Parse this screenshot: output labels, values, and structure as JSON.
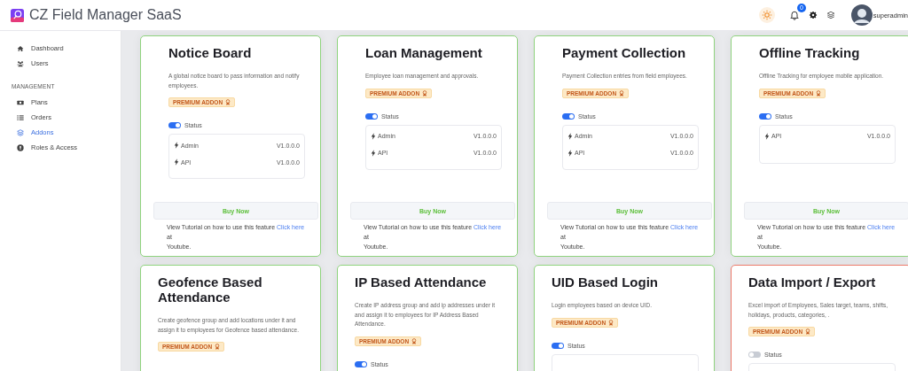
{
  "header": {
    "app_name": "CZ Field Manager SaaS",
    "notification_count": "0",
    "user_name": "superadmin"
  },
  "sidebar": {
    "groups": [
      {
        "items": [
          {
            "label": "Dashboard",
            "selected": false
          },
          {
            "label": "Users",
            "selected": false
          }
        ]
      },
      {
        "heading": "MANAGEMENT",
        "items": [
          {
            "label": "Plans",
            "selected": false
          },
          {
            "label": "Orders",
            "selected": false
          },
          {
            "label": "Addons",
            "selected": true
          },
          {
            "label": "Roles & Access",
            "selected": false
          }
        ]
      }
    ]
  },
  "cards": [
    {
      "title": "Notice Board",
      "description": "A global notice board to pass information and notify employees.",
      "badge": "PREMIUM ADDON",
      "status_label": "Status",
      "status_on": true,
      "modules": [
        {
          "name": "Admin",
          "version": "V1.0.0.0"
        },
        {
          "name": "API",
          "version": "V1.0.0.0"
        }
      ],
      "action": "Buy Now",
      "tutorial": {
        "text": "View Tutorial on how to use this feature",
        "link": "Click here",
        "line_2": "at",
        "line_3": "Youtube."
      }
    },
    {
      "title": "Loan Management",
      "description": "Employee loan management and approvals.",
      "badge": "PREMIUM ADDON",
      "status_label": "Status",
      "status_on": true,
      "modules": [
        {
          "name": "Admin",
          "version": "V1.0.0.0"
        },
        {
          "name": "API",
          "version": "V1.0.0.0"
        }
      ],
      "action": "Buy Now",
      "tutorial": {
        "text": "View Tutorial on how to use this feature",
        "link": "Click here",
        "line_2": "at",
        "line_3": "Youtube."
      }
    },
    {
      "title": "Payment Collection",
      "description": "Payment Collection entries from field employees.",
      "badge": "PREMIUM ADDON",
      "status_label": "Status",
      "status_on": true,
      "modules": [
        {
          "name": "Admin",
          "version": "V1.0.0.0"
        },
        {
          "name": "API",
          "version": "V1.0.0.0"
        }
      ],
      "action": "Buy Now",
      "tutorial": {
        "text": "View Tutorial on how to use this feature",
        "link": "Click here",
        "line_2": "at",
        "line_3": "Youtube."
      }
    },
    {
      "title": "Offline Tracking",
      "description": "Offline Tracking for employee mobile application.",
      "badge": "PREMIUM ADDON",
      "status_label": "Status",
      "status_on": true,
      "modules": [
        {
          "name": "API",
          "version": "V1.0.0.0"
        }
      ],
      "action": "Buy Now",
      "tutorial": {
        "text": "View Tutorial on how to use this feature",
        "link": "Click here",
        "line_2": "at",
        "line_3": "Youtube."
      }
    },
    {
      "title": "Geofence Based Attendance",
      "description": "Create geofence group and add locations under it and assign it to employees for Geofence based attendance.",
      "badge": "PREMIUM ADDON"
    },
    {
      "title": "IP Based Attendance",
      "description": "Create IP address group and add ip addresses under it and assign it to employees for IP Address Based Attendance.",
      "badge": "PREMIUM ADDON",
      "status_label": "Status",
      "status_on": true
    },
    {
      "title": "UID Based Login",
      "description": "Login employees based on device UID.",
      "badge": "PREMIUM ADDON",
      "status_label": "Status",
      "status_on": true
    },
    {
      "title": "Data Import / Export",
      "description": "Excel import of Employees, Sales target, teams, shifts, holidays, products, categories, .",
      "badge": "PREMIUM ADDON",
      "status_label": "Status",
      "status_on": false
    }
  ]
}
